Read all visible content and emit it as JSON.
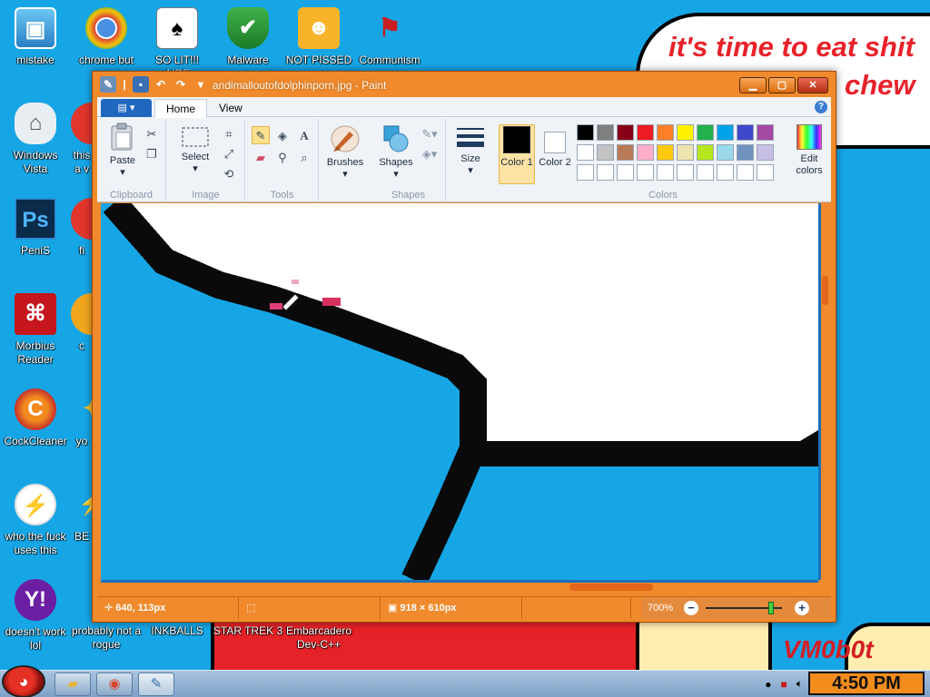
{
  "wallpaper": {
    "bubble_line1": "it's time to eat shit",
    "bubble_line2": "chew",
    "signature": "VM0b0t",
    "accent": "#16a6e6"
  },
  "desktop_icons": [
    {
      "label": "mistake",
      "icon": "computer-icon"
    },
    {
      "label": "chrome but norm",
      "icon": "chrome-icon"
    },
    {
      "label": "SO LIT!!! AIRE",
      "icon": "solitaire-icon"
    },
    {
      "label": "Malware",
      "icon": "shield-icon"
    },
    {
      "label": "NOT PISSED",
      "icon": "bad-piggies-icon"
    },
    {
      "label": "Communism",
      "icon": "flag-icon"
    },
    {
      "label": "Windows Vista",
      "icon": "vista-icon"
    },
    {
      "label": "this a v",
      "icon": "partial-icon"
    },
    {
      "label": "PeniS",
      "icon": "photoshop-icon"
    },
    {
      "label": "fi",
      "icon": "partial-icon"
    },
    {
      "label": "Morbius Reader",
      "icon": "pdf-icon"
    },
    {
      "label": "c",
      "icon": "partial-icon"
    },
    {
      "label": "CockCleaner",
      "icon": "ccleaner-icon"
    },
    {
      "label": "yo",
      "icon": "partial-icon"
    },
    {
      "label": "who the fuck uses this",
      "icon": "winamp-icon"
    },
    {
      "label": "BE",
      "icon": "partial-icon"
    },
    {
      "label": "doesn't work lol",
      "icon": "yahoo-icon"
    },
    {
      "label": "probably not a rogue",
      "icon": "partial-icon"
    },
    {
      "label": "INKBALLS",
      "icon": "inkball-icon"
    },
    {
      "label": "STAR TREK 3",
      "icon": "game-icon"
    },
    {
      "label": "Embarcadero Dev-C++",
      "icon": "ide-icon"
    }
  ],
  "paint": {
    "title": "andimalloutofdolphinporn.jpg - Paint",
    "tabs": {
      "file": "",
      "home": "Home",
      "view": "View"
    },
    "groups": {
      "clipboard": "Clipboard",
      "image": "Image",
      "tools": "Tools",
      "shapes": "Shapes",
      "colors": "Colors"
    },
    "buttons": {
      "paste": "Paste",
      "select": "Select",
      "brushes": "Brushes",
      "shapes": "Shapes",
      "size": "Size",
      "color1": "Color 1",
      "color2": "Color 2",
      "edit_colors": "Edit colors"
    },
    "palette_row1": [
      "#000000",
      "#7f7f7f",
      "#880015",
      "#ed1c24",
      "#ff7f27",
      "#fff200",
      "#22b14c",
      "#00a2e8",
      "#3f48cc",
      "#a349a4"
    ],
    "palette_row2": [
      "#ffffff",
      "#c3c3c3",
      "#b97a57",
      "#ffaec9",
      "#ffc90e",
      "#efe4b0",
      "#b5e61d",
      "#99d9ea",
      "#7092be",
      "#c8bfe7"
    ],
    "color1_value": "#000000",
    "color2_value": "#ffffff",
    "status": {
      "cursor_pos": "640, 113px",
      "image_size": "918 × 610px",
      "zoom": "700%",
      "zoom_level": 0.86
    }
  },
  "taskbar": {
    "clock": "4:50 PM"
  }
}
